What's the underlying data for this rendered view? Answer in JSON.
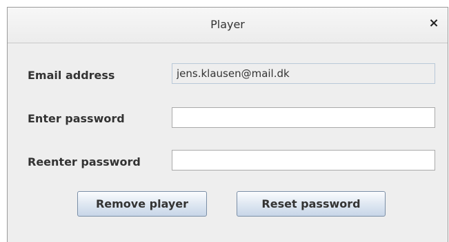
{
  "window": {
    "title": "Player",
    "close_glyph": "×"
  },
  "form": {
    "email": {
      "label": "Email address",
      "value": "jens.klausen@mail.dk"
    },
    "password": {
      "label": "Enter password",
      "value": ""
    },
    "password_repeat": {
      "label": "Reenter password",
      "value": ""
    }
  },
  "buttons": {
    "remove_label": "Remove player",
    "reset_label": "Reset password"
  },
  "icons": {
    "close": "close-icon"
  }
}
